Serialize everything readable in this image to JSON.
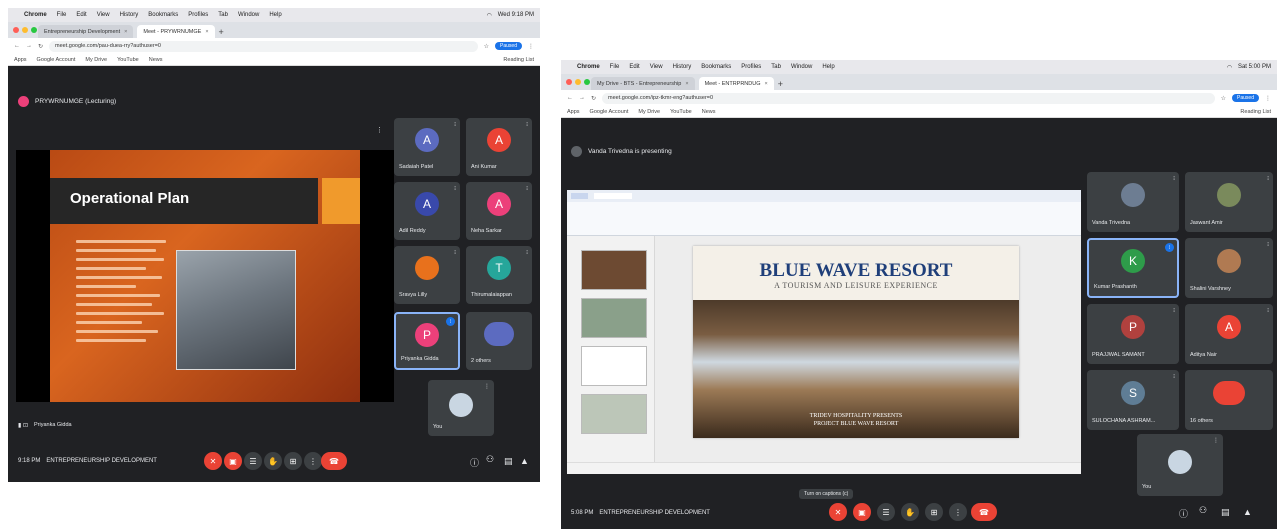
{
  "left": {
    "menubar": {
      "app": "Chrome",
      "items": [
        "File",
        "Edit",
        "View",
        "History",
        "Bookmarks",
        "Profiles",
        "Tab",
        "Window",
        "Help"
      ],
      "right": "Wed 9:18 PM"
    },
    "tabs": [
      {
        "label": "Entrepreneurship Development"
      },
      {
        "label": "Meet - PRYWRNUMGE"
      }
    ],
    "address": "meet.google.com/pau-duea-rry?authuser=0",
    "profile": "Paused",
    "bookmarks": [
      "Apps",
      "Google Account",
      "My Drive",
      "YouTube",
      "News"
    ],
    "bookmarks_right": "Reading List",
    "meeting_title": "PRYWRNUMGE (Lecturing)",
    "slide": {
      "title": "Operational Plan"
    },
    "participants": [
      {
        "initial": "A",
        "name": "Sadaiah Patel",
        "color": "#5c6bc0"
      },
      {
        "initial": "A",
        "name": "Ani Kumar",
        "color": "#ea4335"
      },
      {
        "initial": "A",
        "name": "Adil Reddy",
        "color": "#3949ab"
      },
      {
        "initial": "A",
        "name": "Neha Sarkar",
        "color": "#ec407a"
      },
      {
        "initial": "",
        "name": "Sravya Lilly",
        "color": "#e8711c"
      },
      {
        "initial": "T",
        "name": "Thirumalaiappan",
        "color": "#26a69a"
      },
      {
        "initial": "P",
        "name": "Priyanka Gidda",
        "color": "#ec407a"
      },
      {
        "initial": "",
        "name": "2 others",
        "color": "#5c6bc0"
      }
    ],
    "self_label": "You",
    "presenter_label": "Priyanka Gidda",
    "footer": {
      "time": "9:18 PM",
      "meeting": "ENTREPRENEURSHIP DEVELOPMENT"
    }
  },
  "right": {
    "menubar": {
      "app": "Chrome",
      "items": [
        "File",
        "Edit",
        "View",
        "History",
        "Bookmarks",
        "Profiles",
        "Tab",
        "Window",
        "Help"
      ],
      "right": "Sat 5:00 PM"
    },
    "tabs": [
      {
        "label": "My Drive - BTS - Entrepreneurship"
      },
      {
        "label": "Meet - ENTRPRNDUG"
      }
    ],
    "address": "meet.google.com/ipz-tkmr-eng?authuser=0",
    "profile": "Paused",
    "bookmarks": [
      "Apps",
      "Google Account",
      "My Drive",
      "YouTube",
      "News"
    ],
    "bookmarks_right": "Reading List",
    "meeting_title": "Vanda Trivedna is presenting",
    "slide": {
      "title": "BLUE WAVE RESORT",
      "subtitle": "A TOURISM AND LEISURE EXPERIENCE",
      "footer_line1": "TRIDEV HOSPITALITY PRESENTS",
      "footer_line2": "PROJECT BLUE WAVE RESORT"
    },
    "participants": [
      {
        "initial": "",
        "name": "Vanda Trivedna",
        "color": "#6d7d92"
      },
      {
        "initial": "",
        "name": "Jaswant Amir",
        "color": "#7a8a5c"
      },
      {
        "initial": "K",
        "name": "Kumar Prashanth",
        "color": "#2e9c4a"
      },
      {
        "initial": "",
        "name": "Shalini Varshney",
        "color": "#b07a52"
      },
      {
        "initial": "P",
        "name": "PRAJJWAL SAMANT",
        "color": "#b0413e"
      },
      {
        "initial": "A",
        "name": "Aditya Nair",
        "color": "#ea4335"
      },
      {
        "initial": "S",
        "name": "SULOCHANA ASHRAM...",
        "color": "#5f7d95"
      },
      {
        "initial": "",
        "name": "16 others",
        "color": "#ea4335"
      }
    ],
    "self_label": "You",
    "tooltip": "Turn on captions (c)",
    "footer": {
      "time": "5:08 PM",
      "meeting": "ENTREPRENEURSHIP DEVELOPMENT"
    }
  }
}
